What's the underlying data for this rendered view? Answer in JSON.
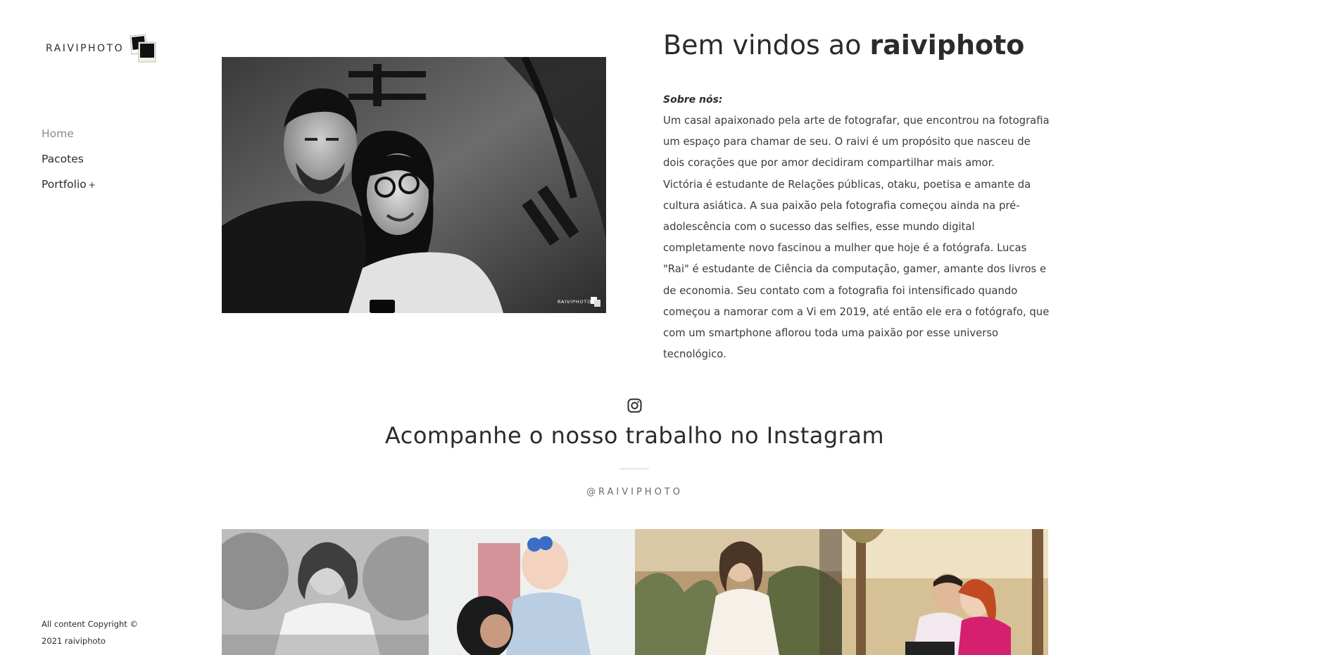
{
  "brand": {
    "logo_text": "RAIVIPHOTO"
  },
  "nav": {
    "items": [
      {
        "label": "Home",
        "active": true
      },
      {
        "label": "Pacotes",
        "active": false
      },
      {
        "label": "Portfolio",
        "active": false,
        "suffix": "+"
      }
    ]
  },
  "footer": {
    "copyright_line1": "All content Copyright ©",
    "copyright_line2": "2021 raiviphoto"
  },
  "hero": {
    "title_prefix": "Bem vindos ao ",
    "title_bold": "raiviphoto",
    "photo_watermark": "RAIVIPHOTO"
  },
  "about": {
    "label": "Sobre nós:",
    "paragraph1": "Um casal apaixonado pela arte de fotografar, que encontrou na fotografia um espaço para chamar de seu. O raivi é um propósito que nasceu de dois corações que por amor decidiram compartilhar mais amor.",
    "paragraph2": "Victória é estudante de Relações públicas, otaku, poetisa e amante da cultura asiática. A sua paixão pela fotografia começou ainda na pré-adolescência com o sucesso das selfies, esse mundo digital completamente novo fascinou a mulher que hoje é a fotógrafa. Lucas \"Rai\" é estudante de Ciência da computação, gamer, amante dos livros e de economia. Seu contato com a fotografia foi intensificado quando começou a namorar com a Vi em 2019, até então ele era o fotógrafo, que com um smartphone aflorou toda uma paixão por esse universo tecnológico."
  },
  "instagram": {
    "icon": "instagram-icon",
    "title": "Acompanhe o nosso trabalho no Instagram",
    "handle": "@RAIVIPHOTO"
  },
  "colors": {
    "text": "#2b2b2b",
    "muted": "#8a8a8a",
    "background": "#ffffff"
  }
}
